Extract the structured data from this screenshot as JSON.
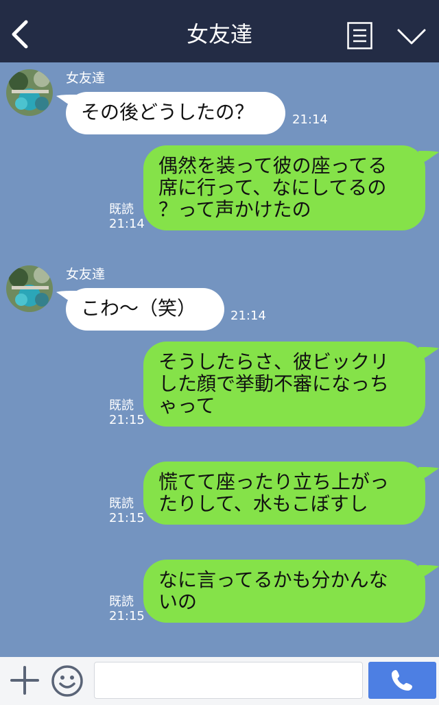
{
  "header": {
    "title": "女友達",
    "icons": {
      "back": "chevron-left-icon",
      "menu": "menu-list-icon",
      "more": "chevron-down-icon"
    }
  },
  "messages": [
    {
      "direction": "in",
      "sender": "女友達",
      "lines": [
        "その後どうしたの？"
      ],
      "time": "21:14"
    },
    {
      "direction": "out",
      "lines": [
        "偶然を装って彼の座ってる",
        "席に行って、なにしてるの",
        "？って声かけたの"
      ],
      "read": "既読",
      "time": "21:14"
    },
    {
      "direction": "in",
      "sender": "女友達",
      "lines": [
        "こわ～（笑）"
      ],
      "time": "21:14"
    },
    {
      "direction": "out",
      "lines": [
        "そうしたらさ、彼ビックリ",
        "した顔で挙動不審になっち",
        "ゃって"
      ],
      "read": "既読",
      "time": "21:15"
    },
    {
      "direction": "out",
      "lines": [
        "慌てて座ったり立ち上がっ",
        "たりして、水もこぼすし"
      ],
      "read": "既読",
      "time": "21:15"
    },
    {
      "direction": "out",
      "lines": [
        "なに言ってるかも分かんな",
        "いの"
      ],
      "read": "既読",
      "time": "21:15"
    }
  ],
  "input_bar": {
    "message_value": "",
    "icons": {
      "add": "plus-icon",
      "emoji": "smiley-icon",
      "call": "phone-icon"
    }
  },
  "colors": {
    "header_bg": "#232c45",
    "chat_bg": "#7494c0",
    "outgoing_bubble": "#85e249",
    "incoming_bubble": "#ffffff",
    "call_button": "#4d7fe3"
  }
}
